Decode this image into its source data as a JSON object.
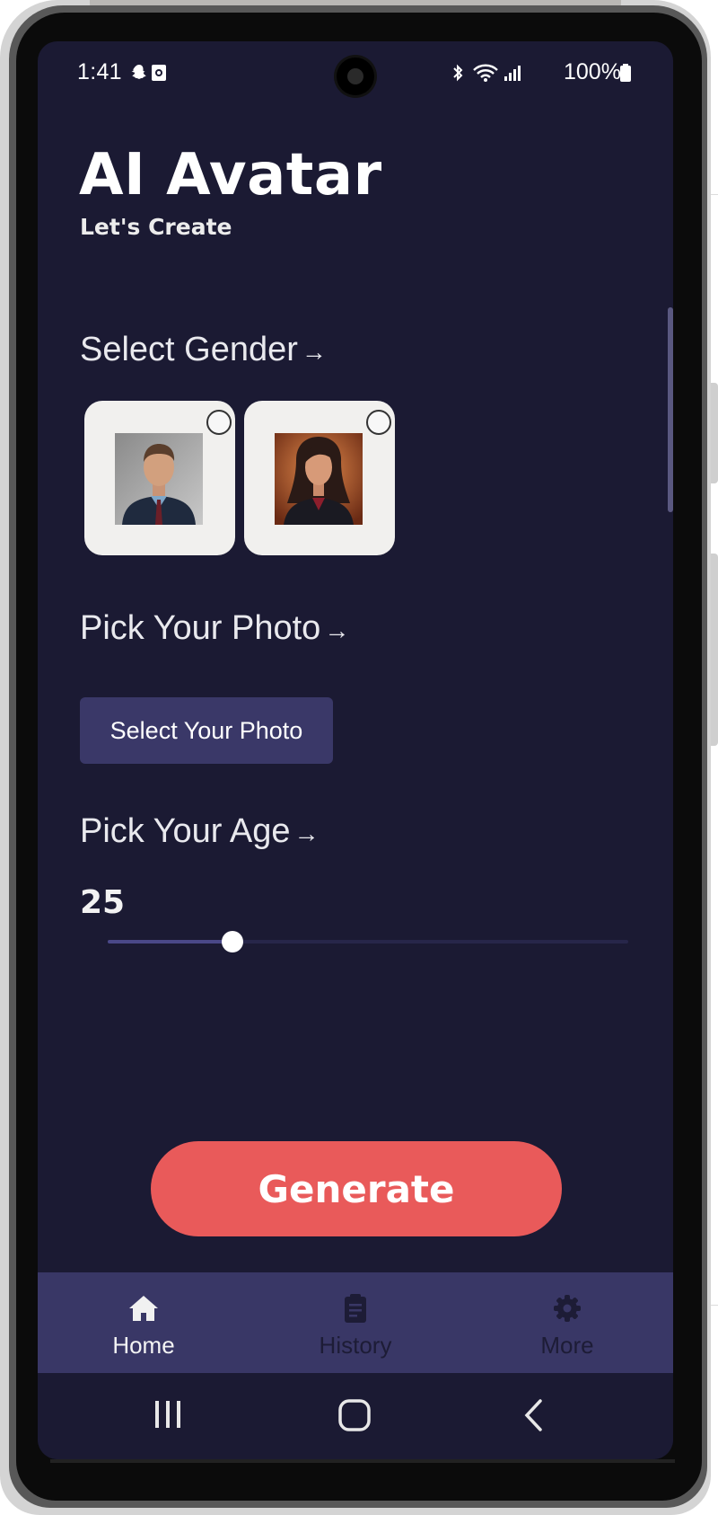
{
  "status_bar": {
    "time": "1:41",
    "battery": "100%",
    "icons": [
      "snapchat-icon",
      "notification-icon",
      "bluetooth-icon",
      "wifi-icon",
      "signal-icon",
      "battery-icon"
    ]
  },
  "header": {
    "title": "AI Avatar",
    "subtitle": "Let's Create"
  },
  "gender": {
    "title": "Select Gender",
    "arrow": "→",
    "options": [
      {
        "label": "male",
        "selected": false
      },
      {
        "label": "female",
        "selected": false
      }
    ]
  },
  "photo": {
    "title": "Pick Your Photo",
    "arrow": "→",
    "button_label": "Select Your Photo"
  },
  "age": {
    "title": "Pick Your Age",
    "arrow": "→",
    "value": "25",
    "slider_fraction": 0.24
  },
  "generate": {
    "label": "Generate"
  },
  "nav": {
    "items": [
      {
        "label": "Home",
        "icon": "home-icon",
        "active": true
      },
      {
        "label": "History",
        "icon": "clipboard-icon",
        "active": false
      },
      {
        "label": "More",
        "icon": "gear-icon",
        "active": false
      }
    ]
  },
  "colors": {
    "background": "#1b1a33",
    "accent": "#e95a5a",
    "nav": "#393766",
    "button": "#3a3868"
  }
}
